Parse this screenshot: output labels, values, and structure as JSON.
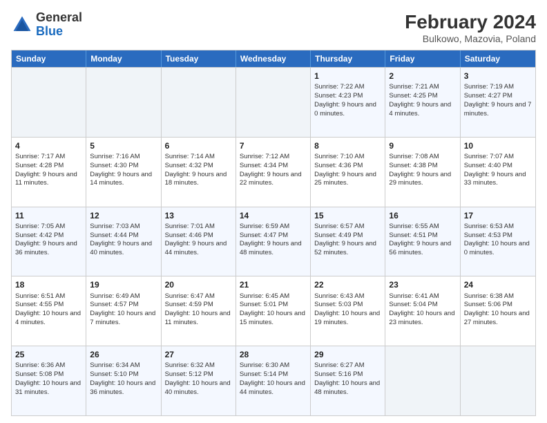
{
  "header": {
    "logo_general": "General",
    "logo_blue": "Blue",
    "title": "February 2024",
    "subtitle": "Bulkowo, Mazovia, Poland"
  },
  "days_of_week": [
    "Sunday",
    "Monday",
    "Tuesday",
    "Wednesday",
    "Thursday",
    "Friday",
    "Saturday"
  ],
  "weeks": [
    [
      {
        "day": "",
        "info": ""
      },
      {
        "day": "",
        "info": ""
      },
      {
        "day": "",
        "info": ""
      },
      {
        "day": "",
        "info": ""
      },
      {
        "day": "1",
        "info": "Sunrise: 7:22 AM\nSunset: 4:23 PM\nDaylight: 9 hours and 0 minutes."
      },
      {
        "day": "2",
        "info": "Sunrise: 7:21 AM\nSunset: 4:25 PM\nDaylight: 9 hours and 4 minutes."
      },
      {
        "day": "3",
        "info": "Sunrise: 7:19 AM\nSunset: 4:27 PM\nDaylight: 9 hours and 7 minutes."
      }
    ],
    [
      {
        "day": "4",
        "info": "Sunrise: 7:17 AM\nSunset: 4:28 PM\nDaylight: 9 hours and 11 minutes."
      },
      {
        "day": "5",
        "info": "Sunrise: 7:16 AM\nSunset: 4:30 PM\nDaylight: 9 hours and 14 minutes."
      },
      {
        "day": "6",
        "info": "Sunrise: 7:14 AM\nSunset: 4:32 PM\nDaylight: 9 hours and 18 minutes."
      },
      {
        "day": "7",
        "info": "Sunrise: 7:12 AM\nSunset: 4:34 PM\nDaylight: 9 hours and 22 minutes."
      },
      {
        "day": "8",
        "info": "Sunrise: 7:10 AM\nSunset: 4:36 PM\nDaylight: 9 hours and 25 minutes."
      },
      {
        "day": "9",
        "info": "Sunrise: 7:08 AM\nSunset: 4:38 PM\nDaylight: 9 hours and 29 minutes."
      },
      {
        "day": "10",
        "info": "Sunrise: 7:07 AM\nSunset: 4:40 PM\nDaylight: 9 hours and 33 minutes."
      }
    ],
    [
      {
        "day": "11",
        "info": "Sunrise: 7:05 AM\nSunset: 4:42 PM\nDaylight: 9 hours and 36 minutes."
      },
      {
        "day": "12",
        "info": "Sunrise: 7:03 AM\nSunset: 4:44 PM\nDaylight: 9 hours and 40 minutes."
      },
      {
        "day": "13",
        "info": "Sunrise: 7:01 AM\nSunset: 4:46 PM\nDaylight: 9 hours and 44 minutes."
      },
      {
        "day": "14",
        "info": "Sunrise: 6:59 AM\nSunset: 4:47 PM\nDaylight: 9 hours and 48 minutes."
      },
      {
        "day": "15",
        "info": "Sunrise: 6:57 AM\nSunset: 4:49 PM\nDaylight: 9 hours and 52 minutes."
      },
      {
        "day": "16",
        "info": "Sunrise: 6:55 AM\nSunset: 4:51 PM\nDaylight: 9 hours and 56 minutes."
      },
      {
        "day": "17",
        "info": "Sunrise: 6:53 AM\nSunset: 4:53 PM\nDaylight: 10 hours and 0 minutes."
      }
    ],
    [
      {
        "day": "18",
        "info": "Sunrise: 6:51 AM\nSunset: 4:55 PM\nDaylight: 10 hours and 4 minutes."
      },
      {
        "day": "19",
        "info": "Sunrise: 6:49 AM\nSunset: 4:57 PM\nDaylight: 10 hours and 7 minutes."
      },
      {
        "day": "20",
        "info": "Sunrise: 6:47 AM\nSunset: 4:59 PM\nDaylight: 10 hours and 11 minutes."
      },
      {
        "day": "21",
        "info": "Sunrise: 6:45 AM\nSunset: 5:01 PM\nDaylight: 10 hours and 15 minutes."
      },
      {
        "day": "22",
        "info": "Sunrise: 6:43 AM\nSunset: 5:03 PM\nDaylight: 10 hours and 19 minutes."
      },
      {
        "day": "23",
        "info": "Sunrise: 6:41 AM\nSunset: 5:04 PM\nDaylight: 10 hours and 23 minutes."
      },
      {
        "day": "24",
        "info": "Sunrise: 6:38 AM\nSunset: 5:06 PM\nDaylight: 10 hours and 27 minutes."
      }
    ],
    [
      {
        "day": "25",
        "info": "Sunrise: 6:36 AM\nSunset: 5:08 PM\nDaylight: 10 hours and 31 minutes."
      },
      {
        "day": "26",
        "info": "Sunrise: 6:34 AM\nSunset: 5:10 PM\nDaylight: 10 hours and 36 minutes."
      },
      {
        "day": "27",
        "info": "Sunrise: 6:32 AM\nSunset: 5:12 PM\nDaylight: 10 hours and 40 minutes."
      },
      {
        "day": "28",
        "info": "Sunrise: 6:30 AM\nSunset: 5:14 PM\nDaylight: 10 hours and 44 minutes."
      },
      {
        "day": "29",
        "info": "Sunrise: 6:27 AM\nSunset: 5:16 PM\nDaylight: 10 hours and 48 minutes."
      },
      {
        "day": "",
        "info": ""
      },
      {
        "day": "",
        "info": ""
      }
    ]
  ]
}
